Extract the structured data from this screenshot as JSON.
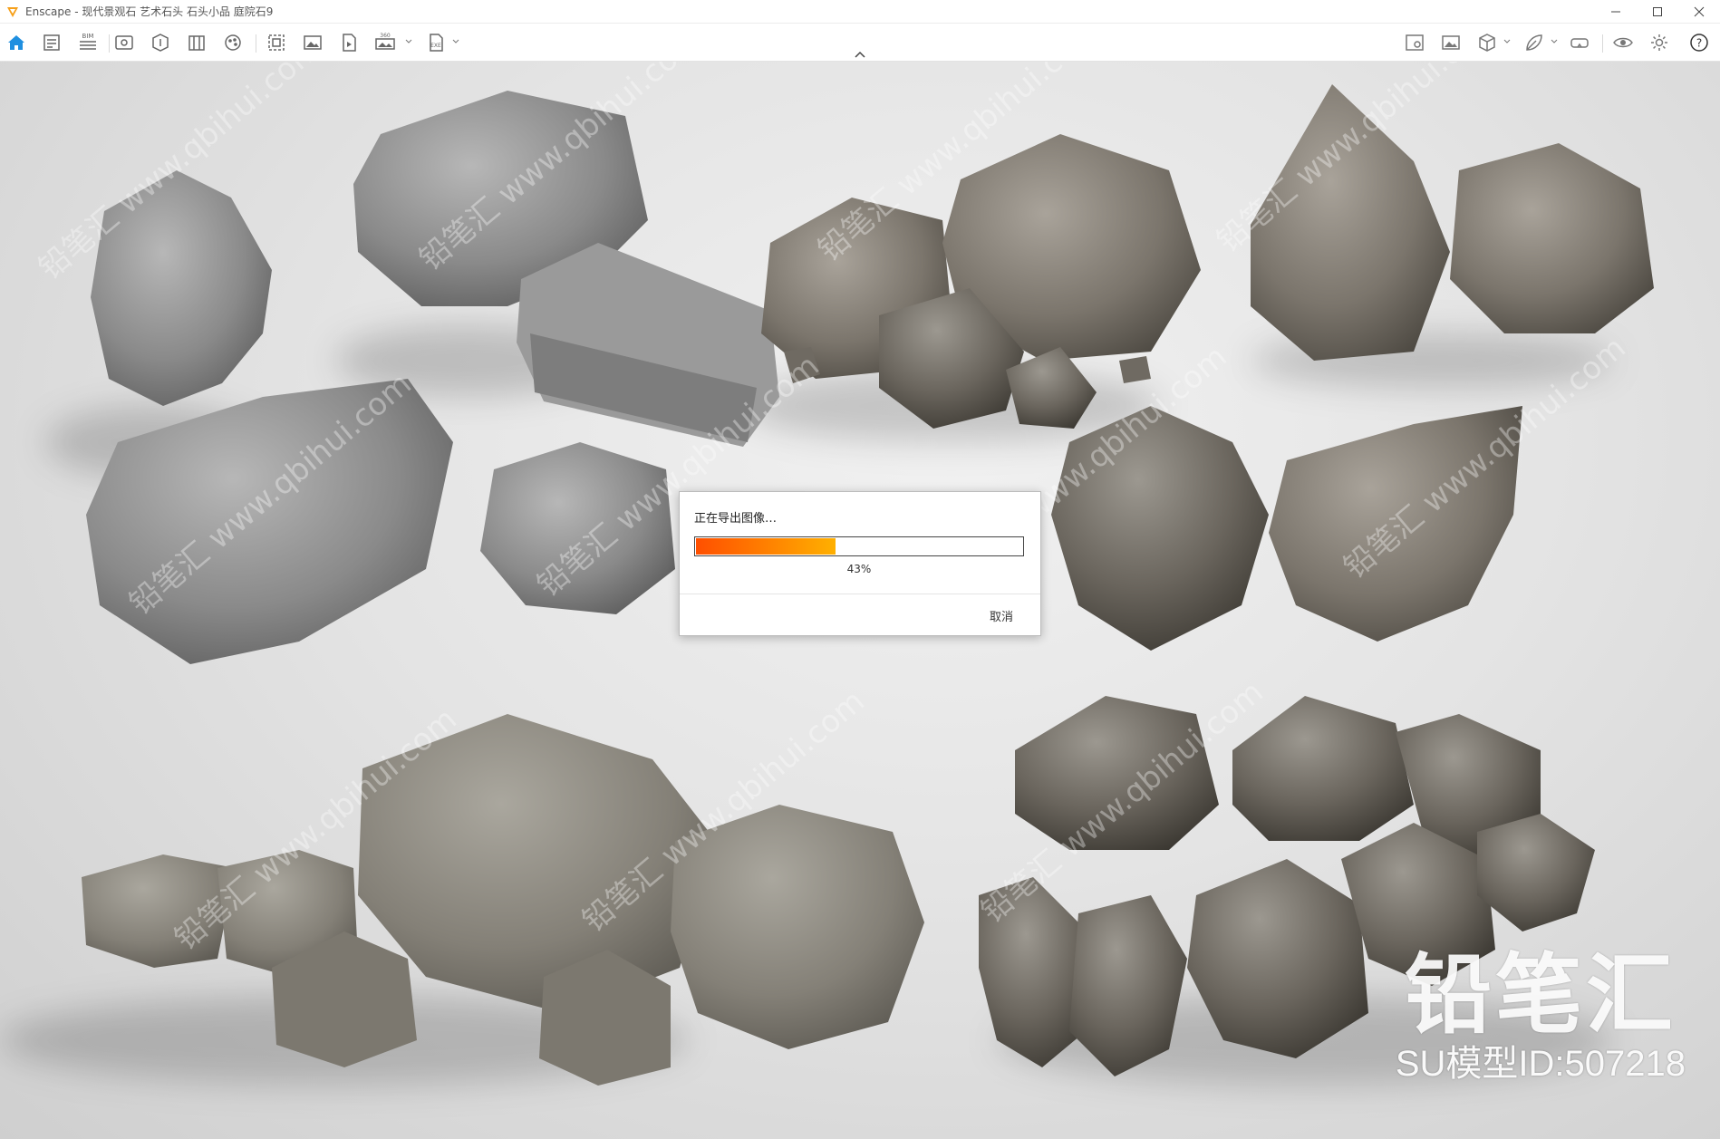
{
  "window": {
    "app_icon": "enscape-logo",
    "title": "Enscape - 现代景观石 艺术石头 石头小品 庭院石9",
    "controls": [
      "minimize-icon",
      "maximize-icon",
      "close-icon"
    ]
  },
  "toolbar": {
    "left_tools": [
      {
        "icon": "home-icon"
      },
      {
        "icon": "properties-icon"
      },
      {
        "icon": "bim-icon",
        "label": "BIM"
      },
      {
        "icon": "views-icon"
      },
      {
        "icon": "visual-settings-icon"
      },
      {
        "icon": "asset-library-icon"
      },
      {
        "icon": "materials-icon"
      },
      {
        "icon": "batch-render-icon"
      },
      {
        "icon": "screenshot-icon"
      },
      {
        "icon": "video-icon"
      },
      {
        "icon": "panorama-icon",
        "label": "360"
      },
      {
        "icon": "export-exe-icon",
        "label": "EXE"
      }
    ],
    "right_tools": [
      {
        "icon": "map-icon"
      },
      {
        "icon": "image-editor-icon"
      },
      {
        "icon": "box-view-icon"
      },
      {
        "icon": "leaf-icon"
      },
      {
        "icon": "vr-headset-icon"
      },
      {
        "icon": "eye-icon"
      },
      {
        "icon": "settings-icon"
      },
      {
        "icon": "help-icon",
        "label": "?"
      }
    ]
  },
  "dialog": {
    "title": "正在导出图像…",
    "progress": 0.43,
    "progress_text": "43%",
    "cancel_label": "取消",
    "colors": {
      "fill_start": "#ff4f00",
      "fill_end": "#ffb000"
    }
  },
  "watermark": {
    "brand": "铅笔汇",
    "model_id": "SU模型ID:507218",
    "tile_text": "铅笔汇 www.qbihui.com"
  }
}
